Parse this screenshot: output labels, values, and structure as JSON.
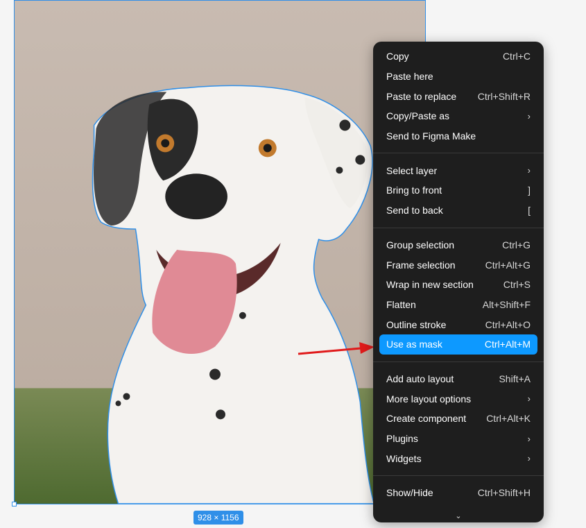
{
  "canvas": {
    "size_badge": "928 × 1156"
  },
  "context_menu": {
    "groups": [
      [
        {
          "label": "Copy",
          "shortcut": "Ctrl+C"
        },
        {
          "label": "Paste here",
          "shortcut": ""
        },
        {
          "label": "Paste to replace",
          "shortcut": "Ctrl+Shift+R"
        },
        {
          "label": "Copy/Paste as",
          "submenu": "›"
        },
        {
          "label": "Send to Figma Make",
          "shortcut": ""
        }
      ],
      [
        {
          "label": "Select layer",
          "submenu": "›"
        },
        {
          "label": "Bring to front",
          "shortcut": "]"
        },
        {
          "label": "Send to back",
          "shortcut": "["
        }
      ],
      [
        {
          "label": "Group selection",
          "shortcut": "Ctrl+G"
        },
        {
          "label": "Frame selection",
          "shortcut": "Ctrl+Alt+G"
        },
        {
          "label": "Wrap in new section",
          "shortcut": "Ctrl+S"
        },
        {
          "label": "Flatten",
          "shortcut": "Alt+Shift+F"
        },
        {
          "label": "Outline stroke",
          "shortcut": "Ctrl+Alt+O"
        },
        {
          "label": "Use as mask",
          "shortcut": "Ctrl+Alt+M"
        }
      ],
      [
        {
          "label": "Add auto layout",
          "shortcut": "Shift+A"
        },
        {
          "label": "More layout options",
          "submenu": "›"
        },
        {
          "label": "Create component",
          "shortcut": "Ctrl+Alt+K"
        },
        {
          "label": "Plugins",
          "submenu": "›"
        },
        {
          "label": "Widgets",
          "submenu": "›"
        }
      ],
      [
        {
          "label": "Show/Hide",
          "shortcut": "Ctrl+Shift+H"
        }
      ]
    ],
    "scroll_indicator": "⌄",
    "highlight_color": "#0d99ff"
  },
  "colors": {
    "selection": "#2f8fe8",
    "menu_bg": "#1e1e1e",
    "annotation_arrow": "#e01b1b"
  }
}
